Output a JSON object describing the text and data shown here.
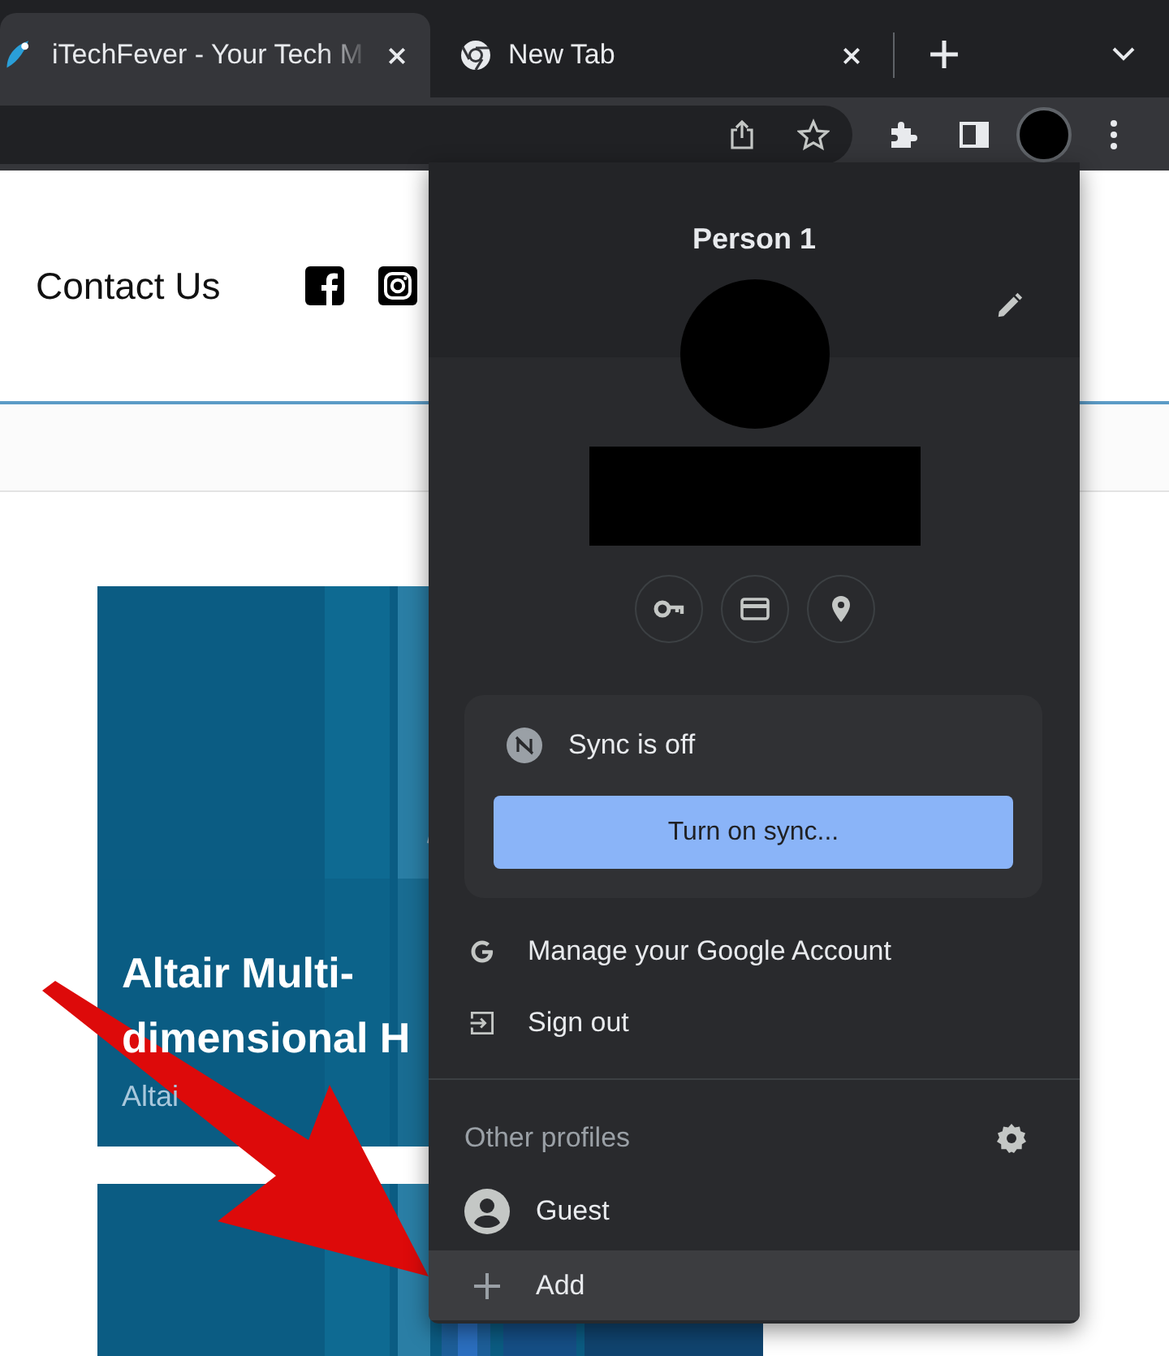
{
  "tabs": [
    {
      "title": "iTechFever - Your Tech M",
      "selected": true
    },
    {
      "title": "New Tab",
      "selected": false
    }
  ],
  "page": {
    "nav_link": "Contact Us",
    "cards": [
      {
        "kind": "article",
        "title": "Altair Multi-dimensional H",
        "subtitle": "Altai"
      },
      {
        "kind": "picture"
      }
    ]
  },
  "profile_menu": {
    "name": "Person 1",
    "sync_status": "Sync is off",
    "sync_button": "Turn on sync...",
    "items": [
      {
        "label": "Manage your Google Account",
        "kind": "google"
      },
      {
        "label": "Sign out",
        "kind": "signout"
      }
    ],
    "other_profiles_heading": "Other profiles",
    "profiles": [
      {
        "label": "Guest",
        "kind": "guest",
        "selected": false
      },
      {
        "label": "Add",
        "kind": "add",
        "selected": true
      }
    ]
  }
}
